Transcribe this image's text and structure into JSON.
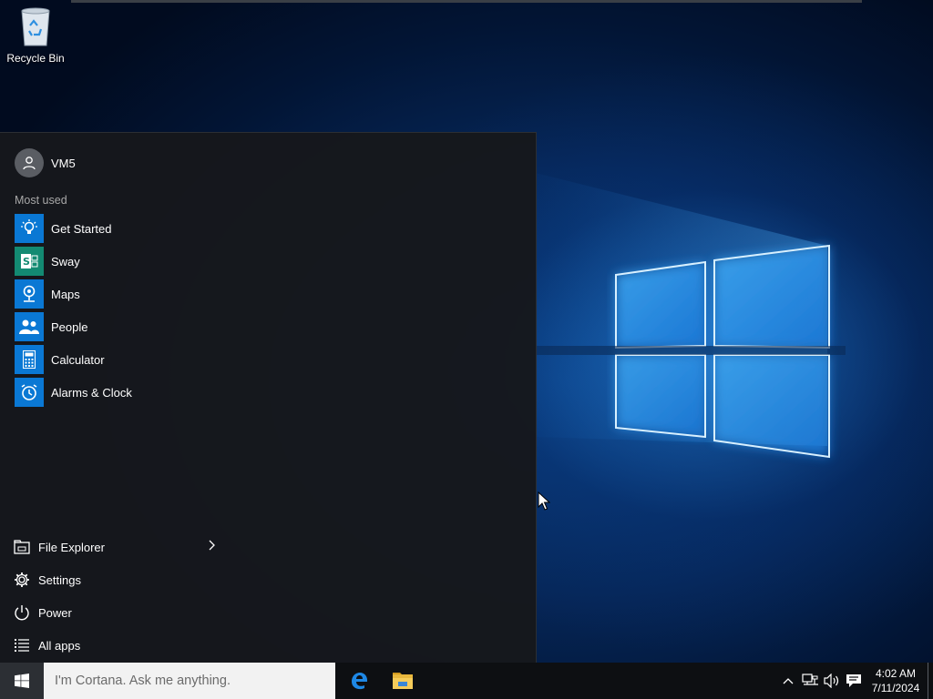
{
  "desktop": {
    "icons": [
      {
        "label": "Recycle Bin",
        "icon": "recycle-bin-icon"
      }
    ]
  },
  "start_menu": {
    "user": {
      "name": "VM5",
      "icon": "user-avatar-icon"
    },
    "most_used_label": "Most used",
    "apps": [
      {
        "label": "Get Started",
        "icon": "lightbulb-icon",
        "color": "#0a78d4"
      },
      {
        "label": "Sway",
        "icon": "sway-icon",
        "color": "#138a72"
      },
      {
        "label": "Maps",
        "icon": "maps-icon",
        "color": "#0a78d4"
      },
      {
        "label": "People",
        "icon": "people-icon",
        "color": "#0a78d4"
      },
      {
        "label": "Calculator",
        "icon": "calculator-icon",
        "color": "#0a78d4"
      },
      {
        "label": "Alarms & Clock",
        "icon": "alarm-clock-icon",
        "color": "#0a78d4"
      }
    ],
    "bottom_items": [
      {
        "label": "File Explorer",
        "icon": "file-explorer-icon",
        "has_submenu": true
      },
      {
        "label": "Settings",
        "icon": "gear-icon"
      },
      {
        "label": "Power",
        "icon": "power-icon"
      },
      {
        "label": "All apps",
        "icon": "list-icon"
      }
    ]
  },
  "taskbar": {
    "start_icon": "windows-logo-icon",
    "search_placeholder": "I'm Cortana. Ask me anything.",
    "pinned": [
      {
        "name": "Microsoft Edge",
        "icon": "edge-icon"
      },
      {
        "name": "File Explorer",
        "icon": "folder-icon"
      }
    ],
    "tray": {
      "icons": [
        "chevron-up-icon",
        "network-icon",
        "volume-icon",
        "action-center-icon"
      ],
      "time": "4:02 AM",
      "date": "7/11/2024"
    }
  },
  "colors": {
    "accent": "#0a78d4",
    "start_menu_bg": "#16181c",
    "taskbar_bg": "#0d0f12"
  }
}
